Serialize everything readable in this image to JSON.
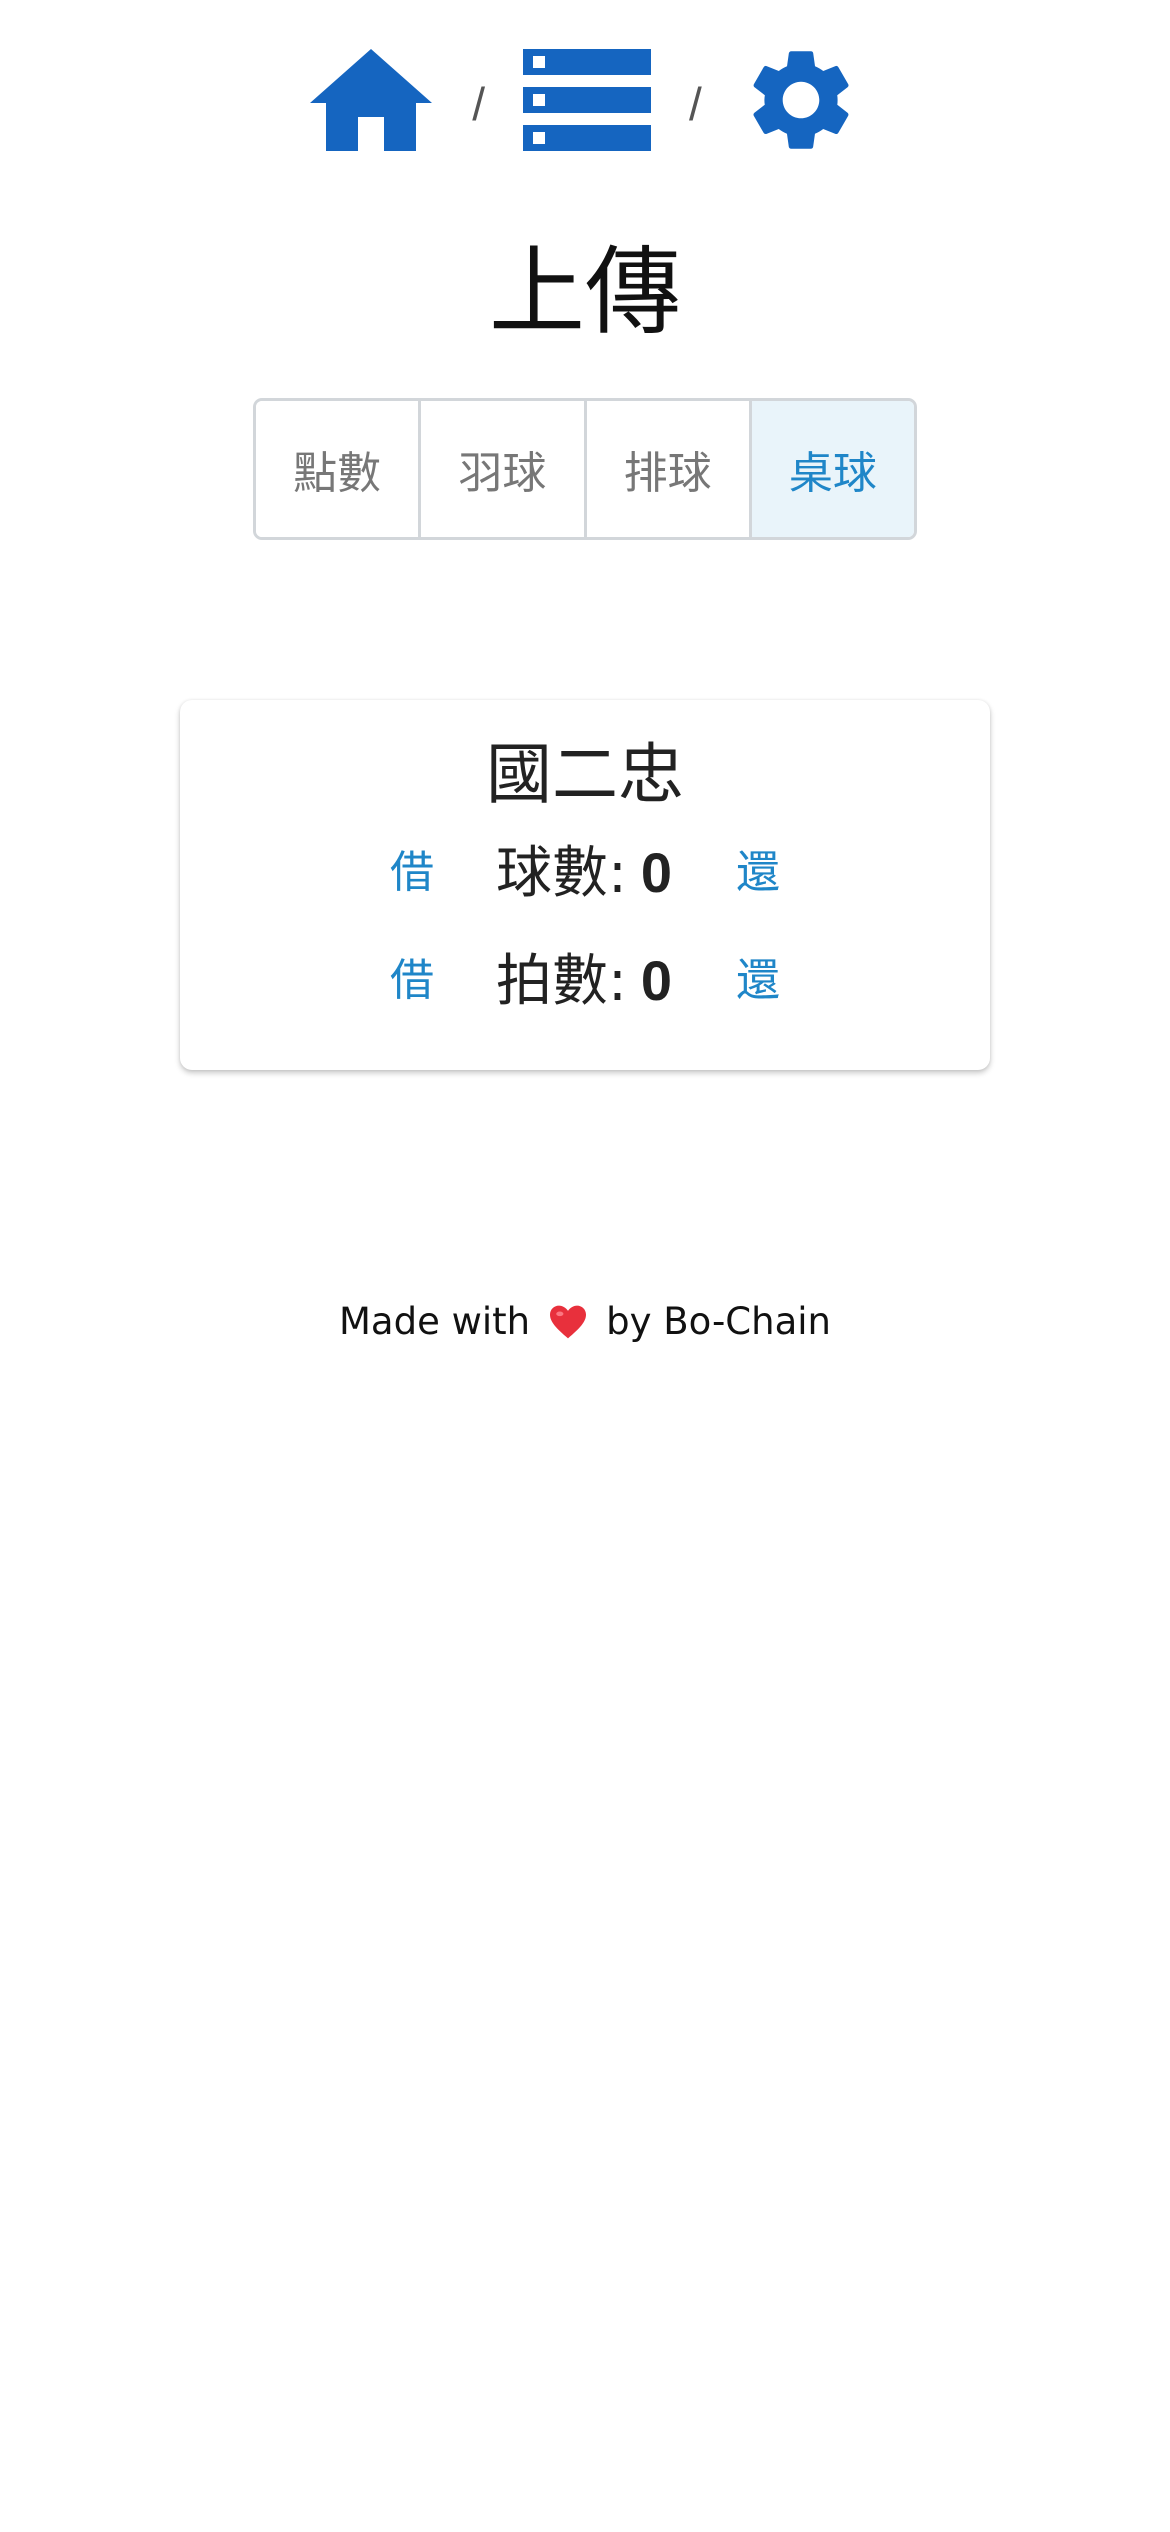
{
  "nav": {
    "icons": [
      "home-icon",
      "list-icon",
      "gear-icon"
    ],
    "separator": "/",
    "accent_color": "#1565c0"
  },
  "title": "上傳",
  "tabs": [
    {
      "label": "點數",
      "active": false
    },
    {
      "label": "羽球",
      "active": false
    },
    {
      "label": "排球",
      "active": false
    },
    {
      "label": "桌球",
      "active": true
    }
  ],
  "card": {
    "title": "國二忠",
    "rows": [
      {
        "borrow_label": "借",
        "name": "球數",
        "value": "0",
        "return_label": "還"
      },
      {
        "borrow_label": "借",
        "name": "拍數",
        "value": "0",
        "return_label": "還"
      }
    ]
  },
  "footer": {
    "prefix": "Made with",
    "icon": "heart-icon",
    "suffix": "by Bo-Chain"
  },
  "colors": {
    "link": "#1f86c8",
    "active_tab_bg": "#e9f4fa",
    "heart": "#e8303c"
  }
}
